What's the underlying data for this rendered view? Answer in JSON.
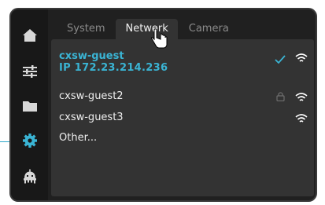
{
  "tabs": [
    {
      "label": "System"
    },
    {
      "label": "Network"
    },
    {
      "label": "Camera"
    }
  ],
  "sidebar": {
    "items": [
      {
        "icon": "home-icon"
      },
      {
        "icon": "sliders-icon"
      },
      {
        "icon": "folder-icon"
      },
      {
        "icon": "gear-icon",
        "active": true
      },
      {
        "icon": "robot-icon"
      }
    ]
  },
  "networks": [
    {
      "ssid": "cxsw-guest",
      "ip": "IP  172.23.214.236",
      "connected": true,
      "locked": false
    },
    {
      "ssid": "cxsw-guest2",
      "connected": false,
      "locked": true
    },
    {
      "ssid": "cxsw-guest3",
      "connected": false,
      "locked": false
    }
  ],
  "other_label": "Other...",
  "colors": {
    "accent": "#3ab4d4",
    "panel": "#333333",
    "background": "#202020"
  }
}
